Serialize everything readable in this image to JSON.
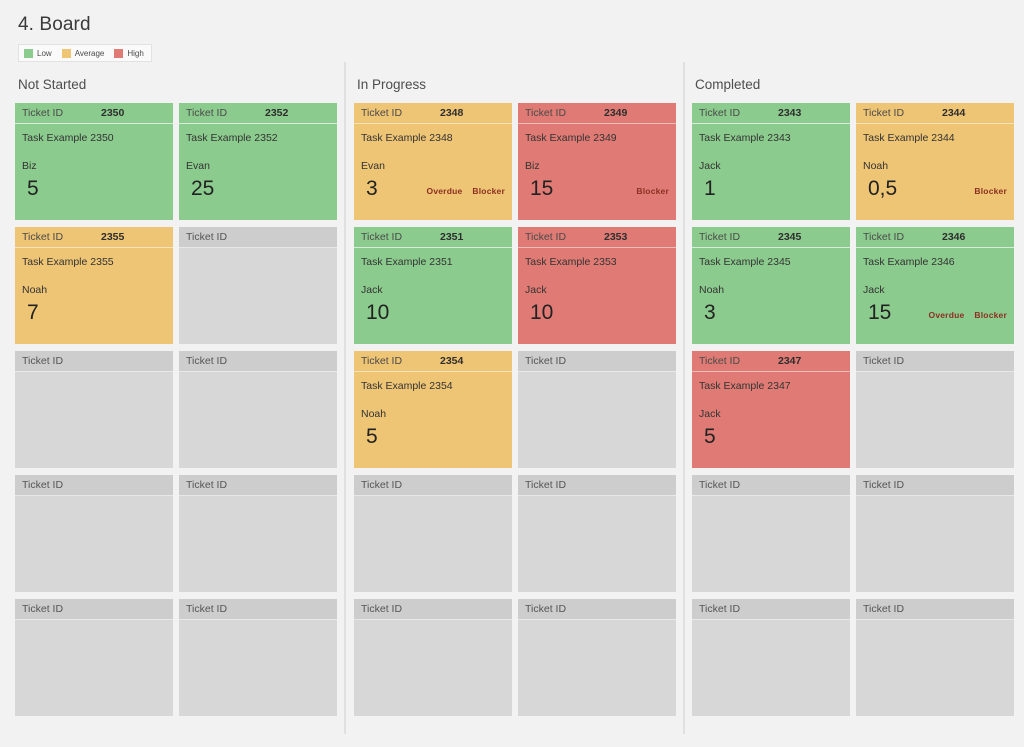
{
  "page": {
    "title": "4. Board",
    "background": "#f2f2f2"
  },
  "legend": {
    "items": [
      {
        "label": "Low",
        "color": "#8ccb8e"
      },
      {
        "label": "Average",
        "color": "#eec475"
      },
      {
        "label": "High",
        "color": "#df7b74"
      }
    ]
  },
  "card_labels": {
    "ticket_id": "Ticket ID",
    "overdue": "Overdue",
    "blocker": "Blocker"
  },
  "tag_color": "#8c2f22",
  "columns": [
    {
      "title": "Not Started",
      "rows": [
        [
          {
            "status": "low",
            "id": "2350",
            "task": "Task Example 2350",
            "owner": "Biz",
            "points": "5",
            "tags": []
          },
          {
            "status": "low",
            "id": "2352",
            "task": "Task Example 2352",
            "owner": "Evan",
            "points": "25",
            "tags": []
          }
        ],
        [
          {
            "status": "avg",
            "id": "2355",
            "task": "Task Example 2355",
            "owner": "Noah",
            "points": "7",
            "tags": []
          },
          {
            "status": "empty",
            "id": "",
            "task": "",
            "owner": "",
            "points": "",
            "tags": []
          }
        ],
        [
          {
            "status": "empty",
            "id": "",
            "task": "",
            "owner": "",
            "points": "",
            "tags": []
          },
          {
            "status": "empty",
            "id": "",
            "task": "",
            "owner": "",
            "points": "",
            "tags": []
          }
        ],
        [
          {
            "status": "empty",
            "id": "",
            "task": "",
            "owner": "",
            "points": "",
            "tags": []
          },
          {
            "status": "empty",
            "id": "",
            "task": "",
            "owner": "",
            "points": "",
            "tags": []
          }
        ],
        [
          {
            "status": "empty",
            "id": "",
            "task": "",
            "owner": "",
            "points": "",
            "tags": []
          },
          {
            "status": "empty",
            "id": "",
            "task": "",
            "owner": "",
            "points": "",
            "tags": []
          }
        ]
      ]
    },
    {
      "title": "In Progress",
      "rows": [
        [
          {
            "status": "avg",
            "id": "2348",
            "task": "Task Example 2348",
            "owner": "Evan",
            "points": "3",
            "tags": [
              "Overdue",
              "Blocker"
            ]
          },
          {
            "status": "high",
            "id": "2349",
            "task": "Task Example 2349",
            "owner": "Biz",
            "points": "15",
            "tags": [
              "Blocker"
            ]
          }
        ],
        [
          {
            "status": "low",
            "id": "2351",
            "task": "Task Example 2351",
            "owner": "Jack",
            "points": "10",
            "tags": []
          },
          {
            "status": "high",
            "id": "2353",
            "task": "Task Example 2353",
            "owner": "Jack",
            "points": "10",
            "tags": []
          }
        ],
        [
          {
            "status": "avg",
            "id": "2354",
            "task": "Task Example 2354",
            "owner": "Noah",
            "points": "5",
            "tags": []
          },
          {
            "status": "empty",
            "id": "",
            "task": "",
            "owner": "",
            "points": "",
            "tags": []
          }
        ],
        [
          {
            "status": "empty",
            "id": "",
            "task": "",
            "owner": "",
            "points": "",
            "tags": []
          },
          {
            "status": "empty",
            "id": "",
            "task": "",
            "owner": "",
            "points": "",
            "tags": []
          }
        ],
        [
          {
            "status": "empty",
            "id": "",
            "task": "",
            "owner": "",
            "points": "",
            "tags": []
          },
          {
            "status": "empty",
            "id": "",
            "task": "",
            "owner": "",
            "points": "",
            "tags": []
          }
        ]
      ]
    },
    {
      "title": "Completed",
      "rows": [
        [
          {
            "status": "low",
            "id": "2343",
            "task": "Task Example 2343",
            "owner": "Jack",
            "points": "1",
            "tags": []
          },
          {
            "status": "avg",
            "id": "2344",
            "task": "Task Example 2344",
            "owner": "Noah",
            "points": "0,5",
            "tags": [
              "Blocker"
            ]
          }
        ],
        [
          {
            "status": "low",
            "id": "2345",
            "task": "Task Example 2345",
            "owner": "Noah",
            "points": "3",
            "tags": []
          },
          {
            "status": "low",
            "id": "2346",
            "task": "Task Example 2346",
            "owner": "Jack",
            "points": "15",
            "tags": [
              "Overdue",
              "Blocker"
            ]
          }
        ],
        [
          {
            "status": "high",
            "id": "2347",
            "task": "Task Example 2347",
            "owner": "Jack",
            "points": "5",
            "tags": []
          },
          {
            "status": "empty",
            "id": "",
            "task": "",
            "owner": "",
            "points": "",
            "tags": []
          }
        ],
        [
          {
            "status": "empty",
            "id": "",
            "task": "",
            "owner": "",
            "points": "",
            "tags": []
          },
          {
            "status": "empty",
            "id": "",
            "task": "",
            "owner": "",
            "points": "",
            "tags": []
          }
        ],
        [
          {
            "status": "empty",
            "id": "",
            "task": "",
            "owner": "",
            "points": "",
            "tags": []
          },
          {
            "status": "empty",
            "id": "",
            "task": "",
            "owner": "",
            "points": "",
            "tags": []
          }
        ]
      ]
    }
  ]
}
